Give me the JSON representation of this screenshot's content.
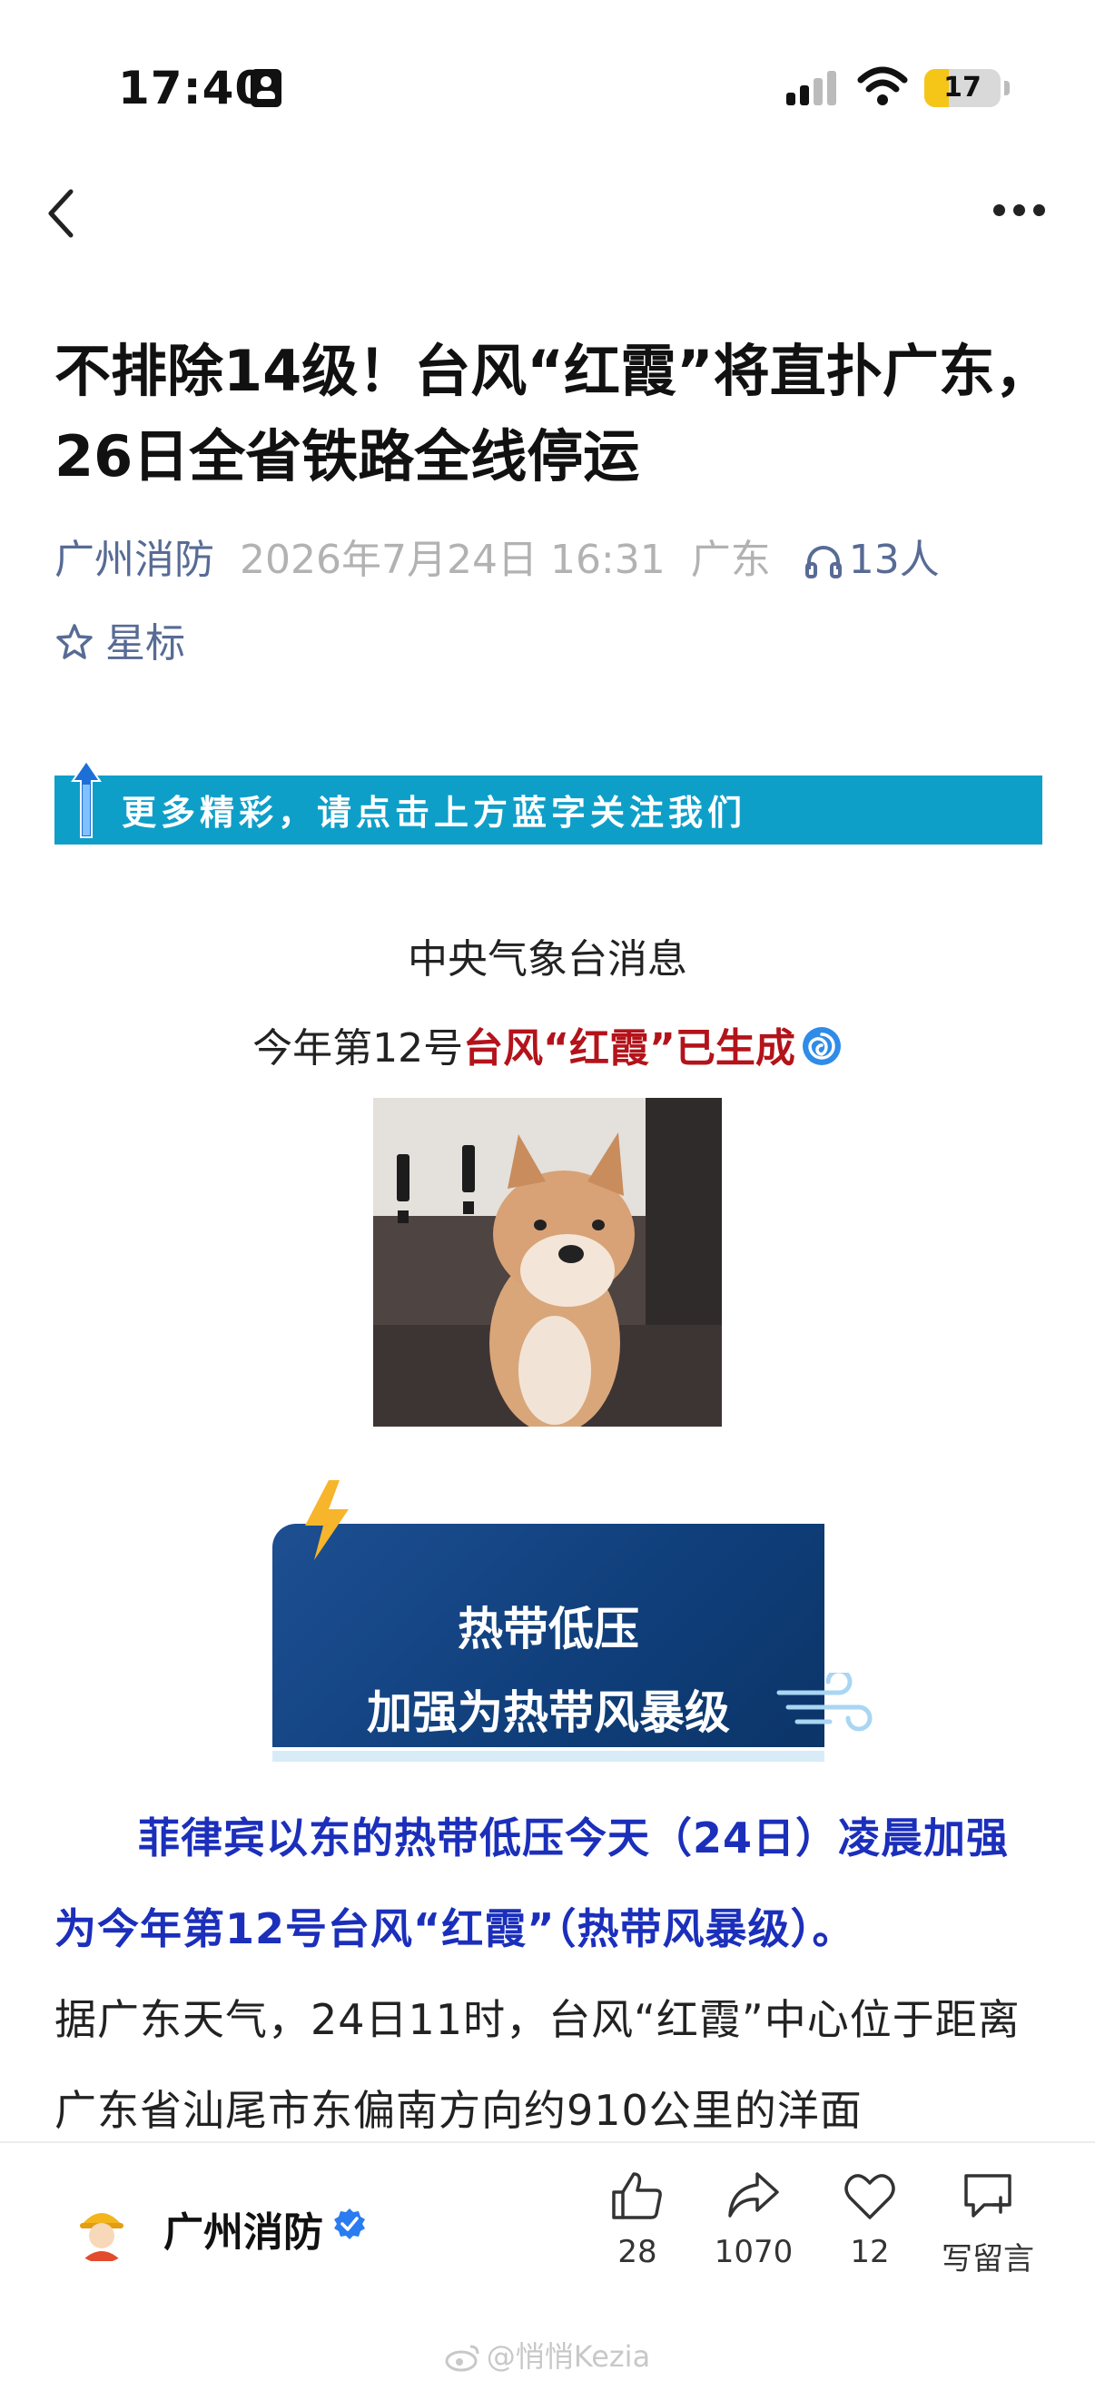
{
  "status_bar": {
    "time": "17:40",
    "battery": "17"
  },
  "article": {
    "title": "不排除14级！台风“红霞”将直扑广东，26日全省铁路全线停运",
    "author": "广州消防",
    "date": "2026年7月24日 16:31",
    "region": "广东",
    "listen_count": "13人",
    "star_label": "星标",
    "follow_banner": "更多精彩，请点击上方蓝字关注我们",
    "source_line": "中央气象台消息",
    "headline_prefix": "今年第12号",
    "headline_red": "台风“红霞”已生成",
    "card_line1": "热带低压",
    "card_line2": "加强为热带风暴级",
    "para1": "菲律宾以东的热带低压今天（24日）凌晨加强为今年第12号台风“红霞”（热带风暴级）。",
    "para2": "据广东天气，24日11时，台风“红霞”中心位于距离广东省汕尾市东偏南方向约910公里的洋面"
  },
  "bottom_bar": {
    "account_name": "广州消防",
    "like_count": "28",
    "share_count": "1070",
    "fav_count": "12",
    "comment_label": "写留言"
  },
  "watermark": "@悄悄Kezia",
  "colors": {
    "link_blue": "#576b95",
    "banner_cyan": "#0e9fc9",
    "highlight_red": "#b3131a",
    "para_blue": "#1b2fbb",
    "card_navy": "#0f3e7a"
  }
}
